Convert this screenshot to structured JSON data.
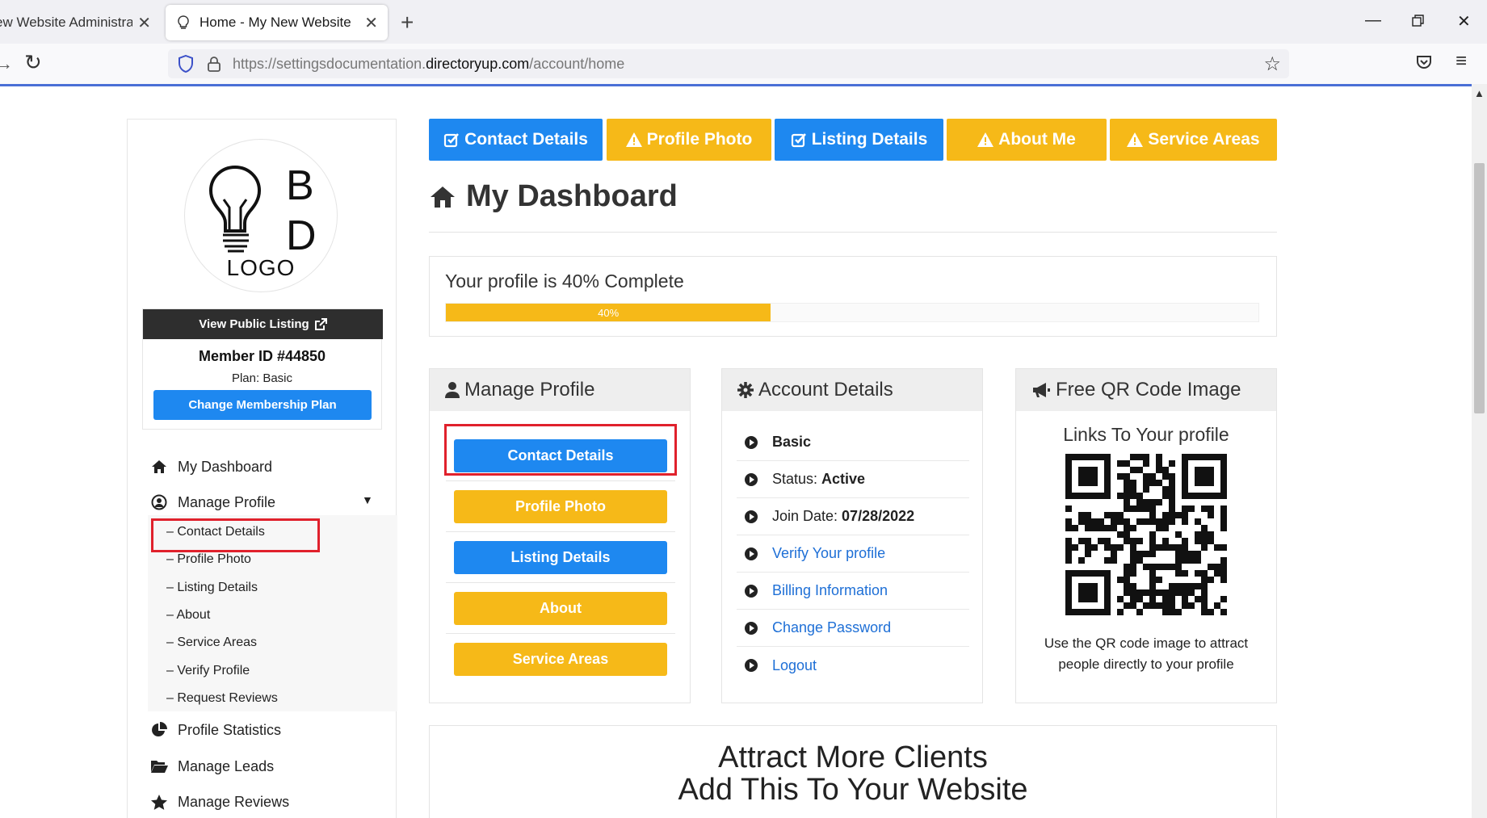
{
  "browser": {
    "tabs": [
      {
        "title": "ew Website Administration",
        "active": false
      },
      {
        "title": "Home - My New Website",
        "active": true
      }
    ],
    "url_prefix": "https://settingsdocumentation.",
    "url_domain": "directoryup.com",
    "url_path": "/account/home"
  },
  "sidebar": {
    "logo_text": "LOGO",
    "logo_letters": [
      "B",
      "D"
    ],
    "view_public_label": "View Public Listing",
    "member_id": "Member ID #44850",
    "plan": "Plan: Basic",
    "change_plan_label": "Change Membership Plan",
    "nav": {
      "dashboard": "My Dashboard",
      "manage_profile": "Manage Profile",
      "sub": [
        "– Contact Details",
        "– Profile Photo",
        "– Listing Details",
        "– About",
        "– Service Areas",
        "– Verify Profile",
        "– Request Reviews"
      ],
      "statistics": "Profile Statistics",
      "leads": "Manage Leads",
      "reviews": "Manage Reviews"
    }
  },
  "top_tabs": [
    {
      "label": "Contact Details",
      "status": "complete",
      "color": "#1e88f0"
    },
    {
      "label": "Profile Photo",
      "status": "warning",
      "color": "#f6b918"
    },
    {
      "label": "Listing Details",
      "status": "complete",
      "color": "#1e88f0"
    },
    {
      "label": "About Me",
      "status": "warning",
      "color": "#f6b918"
    },
    {
      "label": "Service Areas",
      "status": "warning",
      "color": "#f6b918"
    }
  ],
  "dashboard": {
    "title": "My Dashboard",
    "progress_label": "Your profile is 40% Complete",
    "progress_value": 40,
    "progress_text": "40%"
  },
  "manage_profile": {
    "heading": "Manage Profile",
    "buttons": [
      {
        "label": "Contact Details",
        "color": "#1e88f0"
      },
      {
        "label": "Profile Photo",
        "color": "#f6b918"
      },
      {
        "label": "Listing Details",
        "color": "#1e88f0"
      },
      {
        "label": "About",
        "color": "#f6b918"
      },
      {
        "label": "Service Areas",
        "color": "#f6b918"
      }
    ]
  },
  "account_details": {
    "heading": "Account Details",
    "plan": "Basic",
    "status_label": "Status: ",
    "status_value": "Active",
    "join_label": "Join Date: ",
    "join_value": "07/28/2022",
    "links": [
      "Verify Your profile",
      "Billing Information",
      "Change Password",
      "Logout"
    ]
  },
  "qr": {
    "heading": "Free QR Code Image",
    "title": "Links To Your profile",
    "caption": "Use the QR code image to attract people directly to your profile"
  },
  "attract": {
    "line1": "Attract More Clients",
    "line2": "Add This To Your Website"
  },
  "colors": {
    "primary": "#1e88f0",
    "warning": "#f6b918",
    "highlight": "#e0212c"
  }
}
